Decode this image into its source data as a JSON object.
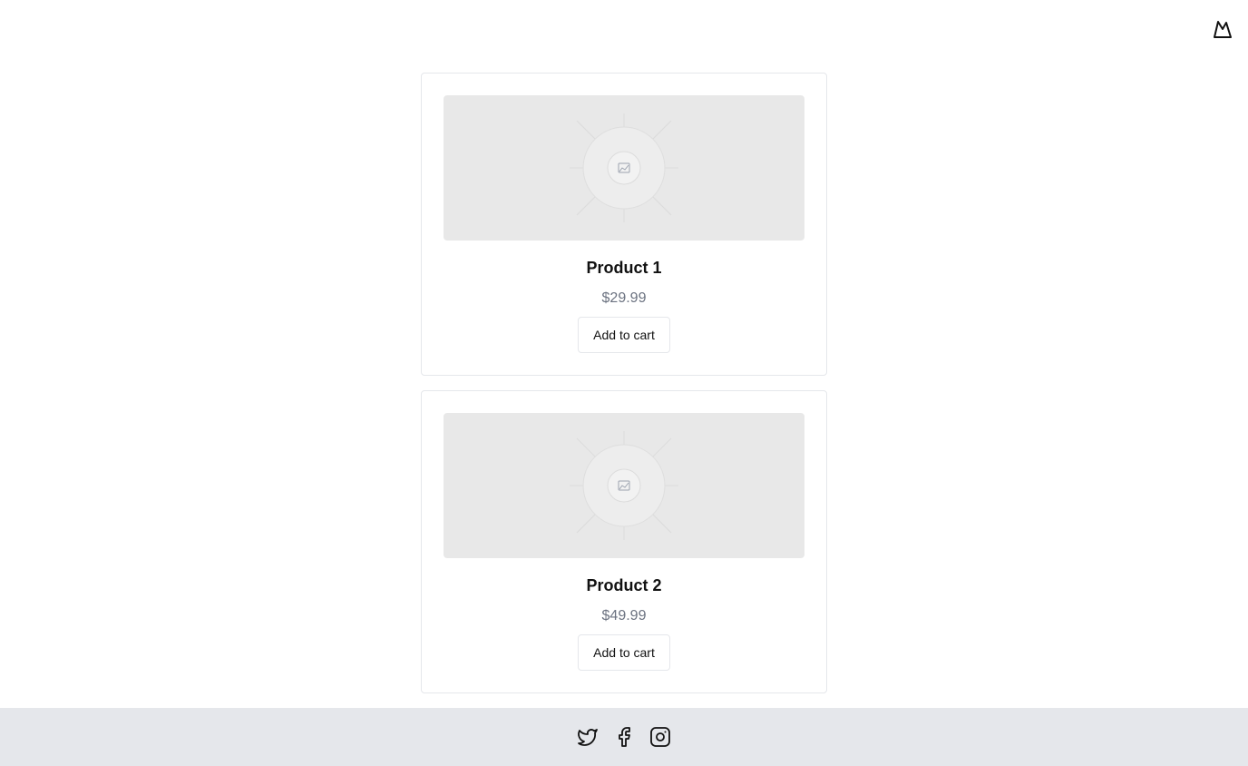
{
  "brand": {
    "logo_icon": "mountain-logo-icon"
  },
  "products": [
    {
      "name": "Product 1",
      "price": "$29.99",
      "button_label": "Add to cart",
      "image_icon": "image-placeholder-icon"
    },
    {
      "name": "Product 2",
      "price": "$49.99",
      "button_label": "Add to cart",
      "image_icon": "image-placeholder-icon"
    }
  ],
  "footer": {
    "social_icons": [
      "twitter-icon",
      "facebook-icon",
      "instagram-icon"
    ],
    "background": "#e5e7eb"
  },
  "colors": {
    "price": "#6b7280",
    "placeholder": "#e8e8e8",
    "border": "#e5e7eb"
  }
}
